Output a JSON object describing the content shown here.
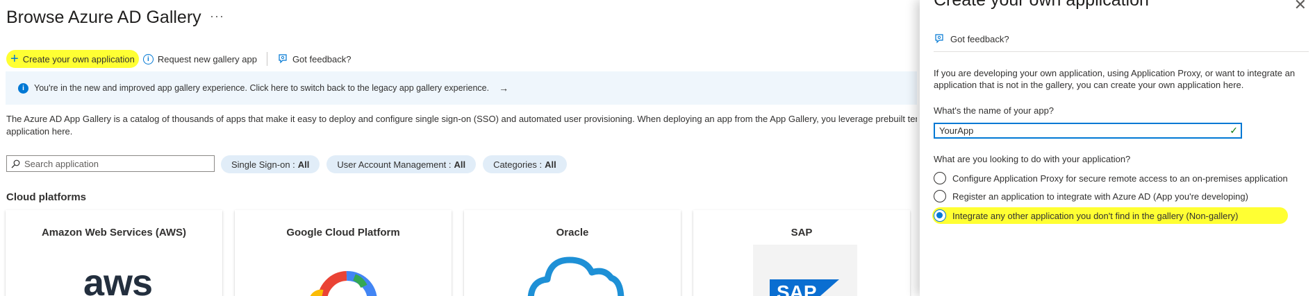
{
  "main": {
    "title": "Browse Azure AD Gallery",
    "more": "···",
    "toolbar": {
      "create": "Create your own application",
      "request": "Request new gallery app",
      "feedback": "Got feedback?"
    },
    "info_bar": "You're in the new and improved app gallery experience. Click here to switch back to the legacy app gallery experience.",
    "description": "The Azure AD App Gallery is a catalog of thousands of apps that make it easy to deploy and configure single sign-on (SSO) and automated user provisioning. When deploying an app from the App Gallery, you leverage prebuilt tem",
    "description_line2": "application here.",
    "search_placeholder": "Search application",
    "filters": [
      {
        "label": "Single Sign-on :",
        "value": "All"
      },
      {
        "label": "User Account Management :",
        "value": "All"
      },
      {
        "label": "Categories :",
        "value": "All"
      }
    ],
    "section_title": "Cloud platforms",
    "cards": [
      {
        "title": "Amazon Web Services (AWS)",
        "logo_text": "aws"
      },
      {
        "title": "Google Cloud Platform"
      },
      {
        "title": "Oracle"
      },
      {
        "title": "SAP",
        "logo_text": "SAP"
      }
    ]
  },
  "panel": {
    "title": "Create your own application",
    "close": "✕",
    "feedback": "Got feedback?",
    "intro": "If you are developing your own application, using Application Proxy, or want to integrate an application that is not in the gallery, you can create your own application here.",
    "name_label": "What's the name of your app?",
    "name_value": "YourApp",
    "question": "What are you looking to do with your application?",
    "options": [
      {
        "label": "Configure Application Proxy for secure remote access to an on-premises application",
        "selected": false
      },
      {
        "label": "Register an application to integrate with Azure AD (App you're developing)",
        "selected": false
      },
      {
        "label": "Integrate any other application you don't find in the gallery (Non-gallery)",
        "selected": true
      }
    ]
  },
  "colors": {
    "accent": "#0078d4",
    "highlight": "#ffff33",
    "info_bg": "#eff6fc",
    "pill_bg": "#e1edf8"
  }
}
